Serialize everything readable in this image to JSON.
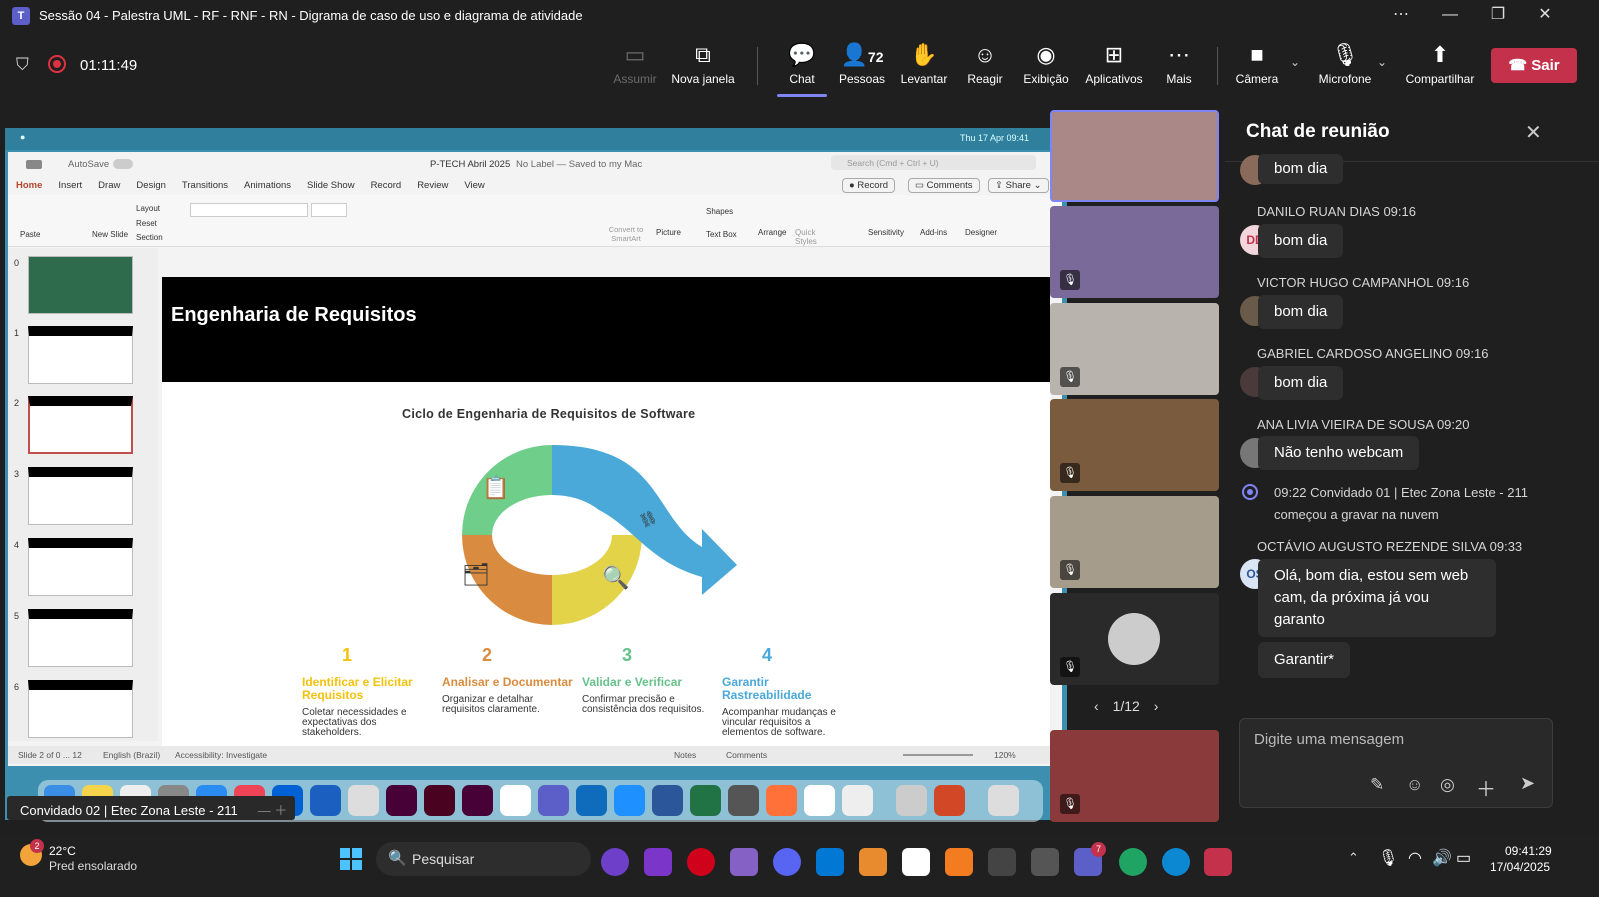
{
  "window": {
    "title": "Sessão 04 - Palestra UML - RF - RNF - RN - Digrama de caso de uso e diagrama de atividade",
    "logo": "T"
  },
  "meeting": {
    "timer": "01:11:49"
  },
  "toolbar": {
    "share_tray": "Assumir",
    "new_window": "Nova janela",
    "chat": "Chat",
    "people": "Pessoas",
    "people_count": "72",
    "raise": "Levantar",
    "react": "Reagir",
    "view": "Exibição",
    "apps": "Aplicativos",
    "more": "Mais",
    "camera": "Câmera",
    "mic": "Microfone",
    "share": "Compartilhar",
    "leave": "Sair"
  },
  "presentation": {
    "mac_date": "Thu 17 Apr  09:41",
    "file_name": "P-TECH Abril 2025",
    "file_label": "No Label — Saved to my Mac",
    "search_placeholder": "Search (Cmd + Ctrl + U)",
    "autosave": "AutoSave",
    "tabs": [
      "Home",
      "Insert",
      "Draw",
      "Design",
      "Transitions",
      "Animations",
      "Slide Show",
      "Record",
      "Review",
      "View"
    ],
    "record_btn": "Record",
    "comments_btn": "Comments",
    "share_btn": "Share",
    "ribbon": [
      "Paste",
      "New Slide",
      "Layout",
      "Reset",
      "Section",
      "Picture",
      "Shapes",
      "Text Box",
      "Arrange",
      "Quick Styles",
      "Sensitivity",
      "Add-ins",
      "Designer",
      "Convert to SmartArt"
    ],
    "thumb_numbers": [
      "0",
      "1",
      "2",
      "3",
      "4",
      "5",
      "6"
    ],
    "slide_title": "Engenharia de Requisitos",
    "diagram_title": "Ciclo de Engenharia de Requisitos de Software",
    "steps": [
      {
        "num": "1",
        "title": "Identificar e Elicitar Requisitos",
        "desc": "Coletar necessidades e expectativas dos stakeholders.",
        "color": "#f4c20d"
      },
      {
        "num": "2",
        "title": "Analisar e Documentar",
        "desc": "Organizar e detalhar requisitos claramente.",
        "color": "#d98c3f"
      },
      {
        "num": "3",
        "title": "Validar e Verificar",
        "desc": "Confirmar precisão e consistência dos requisitos.",
        "color": "#66c28a"
      },
      {
        "num": "4",
        "title": "Garantir Rastreabilidade",
        "desc": "Acompanhar mudanças e vincular requisitos a elementos de software.",
        "color": "#4aa9d8"
      }
    ],
    "status_slide": "Slide 2 of 0 ... 12",
    "status_lang": "English (Brazil)",
    "status_access": "Accessibility: Investigate",
    "status_notes": "Notes",
    "status_comments": "Comments",
    "zoom": "120%",
    "presenter_label": "Convidado 02 | Etec Zona Leste - 211"
  },
  "gallery": {
    "page": "1/12"
  },
  "chat": {
    "title": "Chat de reunião",
    "messages": [
      {
        "name": "",
        "time": "",
        "text": "bom dia"
      },
      {
        "name": "DANILO RUAN DIAS",
        "time": "09:16",
        "text": "bom dia",
        "initials": "DD"
      },
      {
        "name": "VICTOR HUGO CAMPANHOL",
        "time": "09:16",
        "text": "bom dia"
      },
      {
        "name": "GABRIEL CARDOSO ANGELINO",
        "time": "09:16",
        "text": "bom dia"
      },
      {
        "name": "ANA LIVIA VIEIRA DE SOUSA",
        "time": "09:20",
        "text": "Não tenho webcam"
      }
    ],
    "system": {
      "time": "09:22",
      "actor": "Convidado 01 | Etec Zona Leste - 211",
      "text": "começou a gravar na nuvem"
    },
    "last": {
      "name": "OCTÁVIO AUGUSTO REZENDE SILVA",
      "time": "09:33",
      "initials": "OS",
      "lines": [
        "Olá, bom dia, estou sem web",
        "cam, da próxima já vou",
        "garanto"
      ],
      "followup": "Garantir*"
    },
    "input_placeholder": "Digite uma mensagem"
  },
  "taskbar": {
    "weather_temp": "22°C",
    "weather_desc": "Pred ensolarado",
    "weather_badge": "2",
    "search": "Pesquisar",
    "teams_badge": "7",
    "time": "09:41:29",
    "date": "17/04/2025"
  }
}
